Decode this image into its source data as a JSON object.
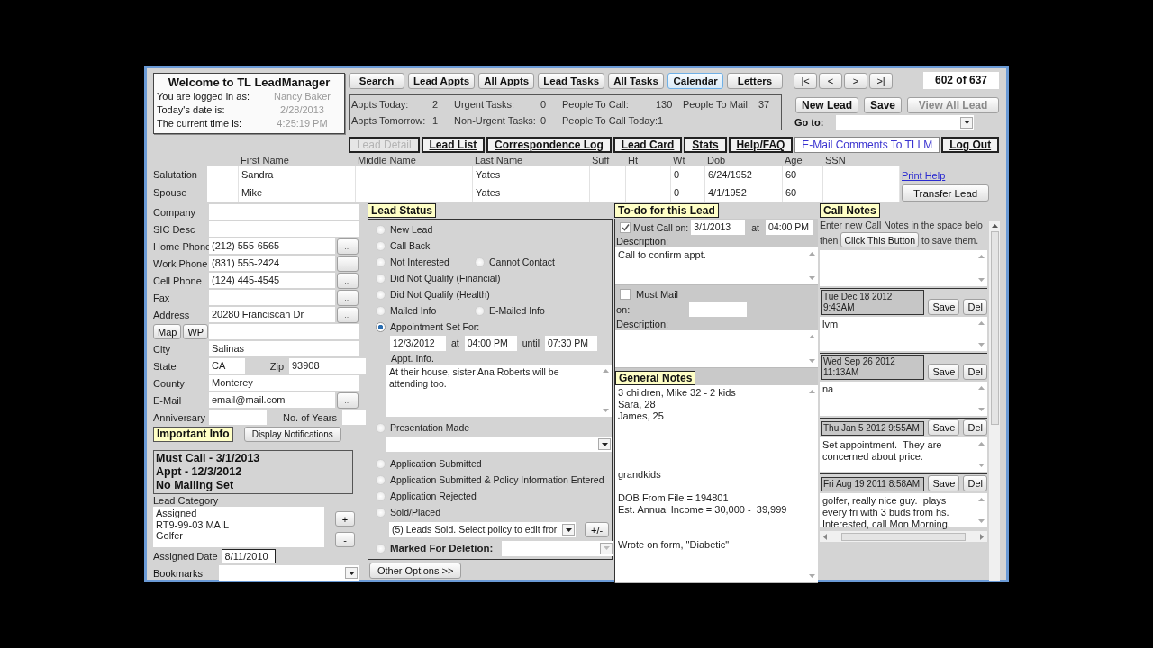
{
  "welcome": {
    "title": "Welcome to TL LeadManager",
    "rows": [
      {
        "label": "You are logged in as:",
        "value": "Nancy Baker"
      },
      {
        "label": "Today's date is:",
        "value": "2/28/2013"
      },
      {
        "label": "The current time is:",
        "value": "4:25:19 PM"
      }
    ]
  },
  "menu_buttons": [
    {
      "label": "Search",
      "selected": false
    },
    {
      "label": "Lead Appts",
      "selected": false
    },
    {
      "label": "All Appts",
      "selected": false
    },
    {
      "label": "Lead Tasks",
      "selected": false
    },
    {
      "label": "All Tasks",
      "selected": false
    },
    {
      "label": "Calendar",
      "selected": true
    },
    {
      "label": "Letters",
      "selected": false
    }
  ],
  "record_nav": {
    "buttons": [
      "|<",
      "<",
      ">",
      ">|"
    ],
    "counter": "602 of 637"
  },
  "stats": [
    [
      {
        "label": "Appts Today:",
        "value": "2"
      },
      {
        "label": "Urgent Tasks:",
        "value": "0"
      },
      {
        "label": "People To Call:",
        "value": "130"
      },
      {
        "label": "People To Mail:",
        "value": "37"
      }
    ],
    [
      {
        "label": "Appts Tomorrow:",
        "value": "1"
      },
      {
        "label": "Non-Urgent Tasks:",
        "value": "0"
      },
      {
        "label": "People To Call Today:",
        "value": "1"
      }
    ]
  ],
  "lead_buttons": [
    {
      "label": "New Lead",
      "disabled": false
    },
    {
      "label": "Save",
      "disabled": false
    },
    {
      "label": "View All Lead",
      "disabled": true
    }
  ],
  "goto": {
    "label": "Go to:"
  },
  "tabs": [
    {
      "label": "Lead Detail",
      "kind": "tab",
      "selected": true
    },
    {
      "label": "Lead List",
      "kind": "tab",
      "selected": false
    },
    {
      "label": "Correspondence Log",
      "kind": "tab",
      "selected": false
    },
    {
      "label": "Lead Card",
      "kind": "tab",
      "selected": false
    },
    {
      "label": "Stats",
      "kind": "tab",
      "selected": false
    },
    {
      "label": "Help/FAQ",
      "kind": "tab",
      "selected": false
    },
    {
      "label": "E-Mail Comments To TLLM",
      "kind": "link",
      "selected": false
    },
    {
      "label": "Log Out",
      "kind": "tab",
      "selected": false
    }
  ],
  "names": {
    "columns": [
      {
        "label": "First Name",
        "values": [
          "Sandra",
          "Mike"
        ]
      },
      {
        "label": "Middle Name"
      },
      {
        "label": "Last Name",
        "values": [
          "Yates",
          "Yates"
        ]
      },
      {
        "label": "Suff"
      },
      {
        "label": "Ht"
      },
      {
        "label": "Wt",
        "values": [
          "0",
          "0"
        ]
      },
      {
        "label": "Dob",
        "values": [
          "6/24/1952",
          "4/1/1952"
        ]
      },
      {
        "label": "Age",
        "values": [
          "60",
          "60"
        ]
      },
      {
        "label": "SSN"
      }
    ],
    "rows": [
      {
        "label": "Salutation",
        "action": {
          "kind": "link",
          "label": "Print Help"
        }
      },
      {
        "label": "Spouse",
        "action": {
          "kind": "button",
          "label": "Transfer Lead"
        }
      }
    ]
  },
  "contact": {
    "fields": [
      {
        "kind": "field",
        "label": "Company"
      },
      {
        "kind": "field",
        "label": "SIC Desc"
      },
      {
        "kind": "lookup",
        "label": "Home Phone",
        "value": "(212) 555-6565",
        "button": "..."
      },
      {
        "kind": "lookup",
        "label": "Work Phone",
        "value": "(831) 555-2424",
        "button": "..."
      },
      {
        "kind": "lookup",
        "label": "Cell Phone",
        "value": "(124) 445-4545",
        "button": "..."
      },
      {
        "kind": "lookup",
        "label": "Fax",
        "button": "..."
      },
      {
        "kind": "lookup",
        "label": "Address",
        "value": "20280 Franciscan Dr",
        "button": "..."
      },
      {
        "kind": "buttons_field",
        "buttons": [
          "Map",
          "WP"
        ]
      },
      {
        "kind": "field",
        "label": "City",
        "value": "Salinas"
      },
      {
        "kind": "pair",
        "label": "State",
        "value": "CA",
        "label2": "Zip",
        "value2": "93908"
      },
      {
        "kind": "field",
        "label": "County",
        "value": "Monterey"
      },
      {
        "kind": "lookup",
        "label": "E-Mail",
        "value": "email@mail.com",
        "button": "..."
      },
      {
        "kind": "pair",
        "label": "Anniversary",
        "label2": "No. of Years"
      }
    ],
    "important": {
      "label": "Important Info",
      "button": "Display Notifications"
    },
    "alerts": [
      "Must Call - 3/1/2013",
      "Appt - 12/3/2012",
      "No Mailing Set"
    ],
    "category": {
      "label": "Lead Category",
      "items": [
        "Assigned",
        "RT9-99-03 MAIL",
        "Golfer"
      ],
      "buttons": [
        "+",
        "-"
      ]
    },
    "assigned": {
      "label": "Assigned Date",
      "value": "8/11/2010"
    },
    "bookmarks": {
      "label": "Bookmarks"
    }
  },
  "lead_status": {
    "title": "Lead Status",
    "rows": [
      {
        "kind": "options",
        "options": [
          {
            "label": "New Lead",
            "selected": false
          }
        ]
      },
      {
        "kind": "options",
        "options": [
          {
            "label": "Call Back",
            "selected": false
          }
        ]
      },
      {
        "kind": "options",
        "options": [
          {
            "label": "Not Interested",
            "selected": false
          },
          {
            "label": "Cannot Contact",
            "selected": false
          }
        ]
      },
      {
        "kind": "options",
        "options": [
          {
            "label": "Did Not Qualify (Financial)",
            "selected": false
          }
        ]
      },
      {
        "kind": "options",
        "options": [
          {
            "label": "Did Not Qualify (Health)",
            "selected": false
          }
        ]
      },
      {
        "kind": "options",
        "options": [
          {
            "label": "Mailed Info",
            "selected": false
          },
          {
            "label": "E-Mailed Info",
            "selected": false
          }
        ]
      },
      {
        "kind": "appointment",
        "options": [
          {
            "label": "Appointment Set For:",
            "selected": true
          }
        ],
        "date": "12/3/2012",
        "at_label": "at",
        "start": "04:00 PM",
        "until_label": "until",
        "end": "07:30 PM",
        "info_label": "Appt. Info.",
        "info": "At their house, sister Ana Roberts will be attending too."
      },
      {
        "kind": "select",
        "options": [
          {
            "label": "Presentation Made",
            "selected": false
          }
        ]
      },
      {
        "kind": "options",
        "options": [
          {
            "label": "Application Submitted",
            "selected": false
          }
        ]
      },
      {
        "kind": "options",
        "options": [
          {
            "label": "Application Submitted & Policy Information Entered",
            "selected": false
          }
        ]
      },
      {
        "kind": "options",
        "options": [
          {
            "label": "Application Rejected",
            "selected": false
          }
        ]
      },
      {
        "kind": "sold",
        "options": [
          {
            "label": "Sold/Placed",
            "selected": false
          }
        ],
        "value": "(5) Leads Sold. Select policy to edit fror",
        "button": "+/-"
      },
      {
        "kind": "deletion",
        "options": [
          {
            "label": "Marked For Deletion:",
            "selected": false
          }
        ]
      }
    ],
    "more_button": "Other Options >>"
  },
  "todo": {
    "title": "To-do for this Lead",
    "must_call": {
      "checked": true,
      "label": "Must Call on:",
      "date": "3/1/2013",
      "at_label": "at",
      "time": "04:00 PM",
      "description_label": "Description:",
      "description": "Call to confirm appt."
    },
    "must_mail": {
      "checked": false,
      "label": "Must Mail",
      "on_label": "on:",
      "description_label": "Description:"
    },
    "general_notes": {
      "title": "General Notes",
      "text": "3 children, Mike 32 - 2 kids\nSara, 28\nJames, 25\n\n\n\n\ngrandkids\n\nDOB From File = 194801\nEst. Annual Income = 30,000 -  39,999\n\n\nWrote on form, \"Diabetic\""
    }
  },
  "call_notes": {
    "title": "Call Notes",
    "instructions": "Enter new Call Notes in the space belo",
    "then_label": "then",
    "save_button": "Click This Button",
    "after_label": "to save them.",
    "notes": [
      {
        "date": "Tue Dec 18 2012 9:43AM",
        "text": "lvm",
        "buttons": [
          "Save",
          "Del"
        ]
      },
      {
        "date": "Wed Sep 26 2012 11:13AM",
        "text": "na",
        "buttons": [
          "Save",
          "Del"
        ]
      },
      {
        "date": "Thu Jan 5 2012 9:55AM",
        "text": "Set appointment.  They are concerned about price.",
        "buttons": [
          "Save",
          "Del"
        ]
      },
      {
        "date": "Fri Aug 19 2011 8:58AM",
        "text": "golfer, really nice guy.  plays every fri with 3 buds from hs.\nInterested, call Mon Morning.",
        "buttons": [
          "Save",
          "Del"
        ]
      }
    ]
  }
}
